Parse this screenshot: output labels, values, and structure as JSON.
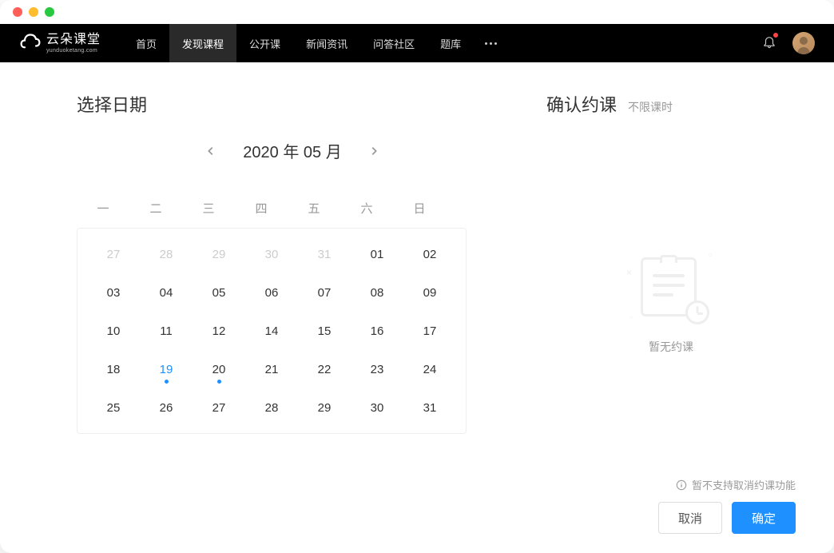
{
  "nav": {
    "logo_main": "云朵课堂",
    "logo_sub": "yunduoketang.com",
    "items": [
      "首页",
      "发现课程",
      "公开课",
      "新闻资讯",
      "问答社区",
      "题库"
    ],
    "active_index": 1
  },
  "calendar": {
    "title": "选择日期",
    "month_label": "2020 年 05 月",
    "weekdays": [
      "一",
      "二",
      "三",
      "四",
      "五",
      "六",
      "日"
    ],
    "days": [
      {
        "n": "27",
        "muted": true
      },
      {
        "n": "28",
        "muted": true
      },
      {
        "n": "29",
        "muted": true
      },
      {
        "n": "30",
        "muted": true
      },
      {
        "n": "31",
        "muted": true
      },
      {
        "n": "01"
      },
      {
        "n": "02"
      },
      {
        "n": "03"
      },
      {
        "n": "04"
      },
      {
        "n": "05"
      },
      {
        "n": "06"
      },
      {
        "n": "07"
      },
      {
        "n": "08"
      },
      {
        "n": "09"
      },
      {
        "n": "10"
      },
      {
        "n": "11"
      },
      {
        "n": "12"
      },
      {
        "n": "14"
      },
      {
        "n": "15"
      },
      {
        "n": "16"
      },
      {
        "n": "17"
      },
      {
        "n": "18"
      },
      {
        "n": "19",
        "today": true,
        "dot": true
      },
      {
        "n": "20",
        "dot": true
      },
      {
        "n": "21"
      },
      {
        "n": "22"
      },
      {
        "n": "23"
      },
      {
        "n": "24"
      },
      {
        "n": "25"
      },
      {
        "n": "26"
      },
      {
        "n": "27"
      },
      {
        "n": "28"
      },
      {
        "n": "29"
      },
      {
        "n": "30"
      },
      {
        "n": "31"
      }
    ]
  },
  "confirm": {
    "title": "确认约课",
    "sub": "不限课时",
    "empty_text": "暂无约课",
    "hint": "暂不支持取消约课功能",
    "cancel_label": "取消",
    "ok_label": "确定"
  }
}
